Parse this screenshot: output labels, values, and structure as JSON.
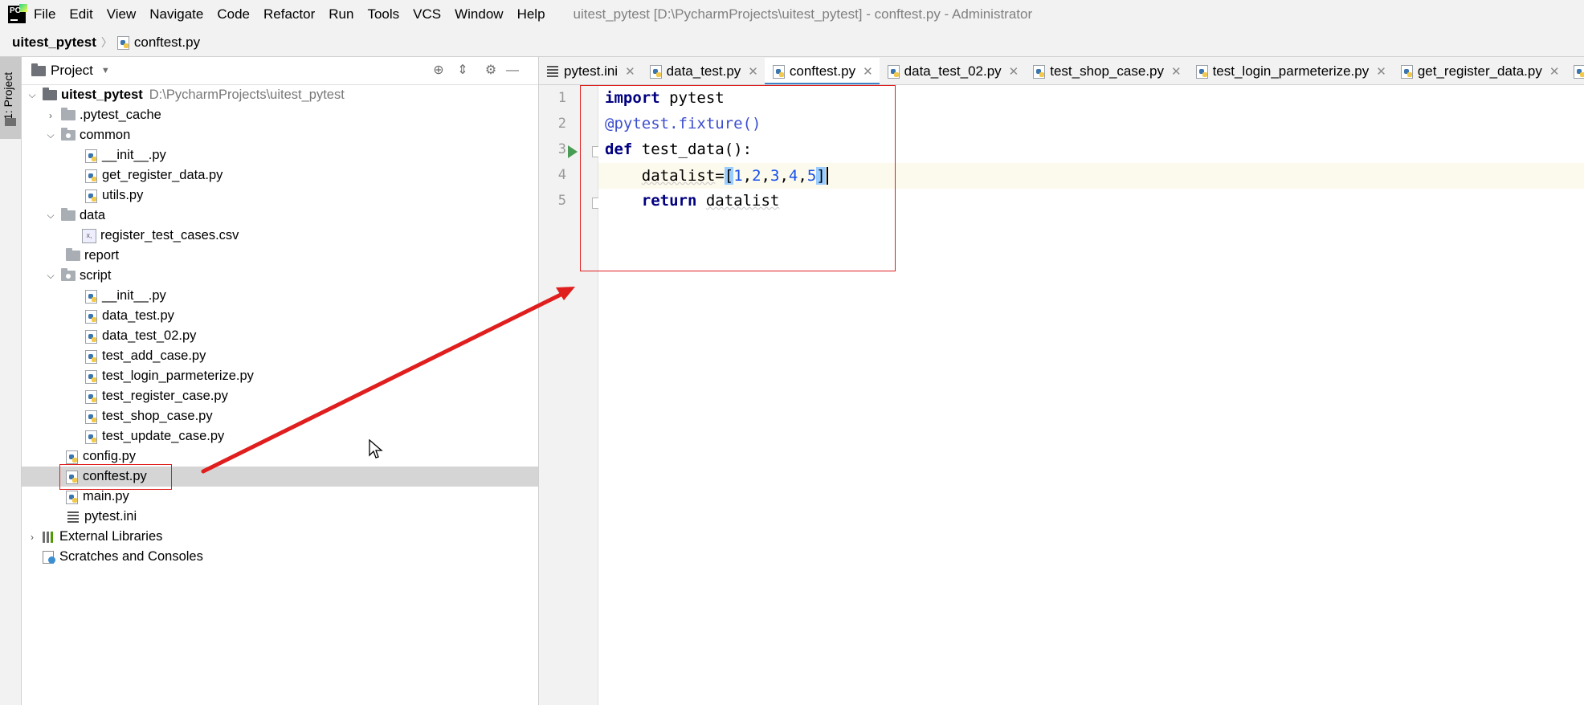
{
  "menubar": {
    "items": [
      "File",
      "Edit",
      "View",
      "Navigate",
      "Code",
      "Refactor",
      "Run",
      "Tools",
      "VCS",
      "Window",
      "Help"
    ],
    "title": "uitest_pytest [D:\\PycharmProjects\\uitest_pytest] - conftest.py - Administrator"
  },
  "breadcrumb": {
    "root": "uitest_pytest",
    "file": "conftest.py"
  },
  "tool_stripe": {
    "label": "1: Project"
  },
  "project_panel": {
    "title": "Project",
    "tree": [
      {
        "label": "uitest_pytest",
        "path": "D:\\PycharmProjects\\uitest_pytest",
        "type": "root-folder",
        "expanded": true
      },
      {
        "label": ".pytest_cache",
        "type": "folder",
        "expanded": false
      },
      {
        "label": "common",
        "type": "package",
        "expanded": true
      },
      {
        "label": "__init__.py",
        "type": "python"
      },
      {
        "label": "get_register_data.py",
        "type": "python"
      },
      {
        "label": "utils.py",
        "type": "python"
      },
      {
        "label": "data",
        "type": "folder",
        "expanded": true
      },
      {
        "label": "register_test_cases.csv",
        "type": "csv"
      },
      {
        "label": "report",
        "type": "folder"
      },
      {
        "label": "script",
        "type": "package",
        "expanded": true
      },
      {
        "label": "__init__.py",
        "type": "python"
      },
      {
        "label": "data_test.py",
        "type": "python"
      },
      {
        "label": "data_test_02.py",
        "type": "python"
      },
      {
        "label": "test_add_case.py",
        "type": "python"
      },
      {
        "label": "test_login_parmeterize.py",
        "type": "python"
      },
      {
        "label": "test_register_case.py",
        "type": "python"
      },
      {
        "label": "test_shop_case.py",
        "type": "python"
      },
      {
        "label": "test_update_case.py",
        "type": "python"
      },
      {
        "label": "config.py",
        "type": "python"
      },
      {
        "label": "conftest.py",
        "type": "python",
        "selected": true
      },
      {
        "label": "main.py",
        "type": "python"
      },
      {
        "label": "pytest.ini",
        "type": "ini"
      },
      {
        "label": "External Libraries",
        "type": "libraries",
        "expanded": false
      },
      {
        "label": "Scratches and Consoles",
        "type": "scratches"
      }
    ]
  },
  "editor": {
    "tabs": [
      {
        "label": "pytest.ini",
        "icon": "ini-file-icon"
      },
      {
        "label": "data_test.py",
        "icon": "python-file-icon"
      },
      {
        "label": "conftest.py",
        "icon": "python-file-icon",
        "active": true
      },
      {
        "label": "data_test_02.py",
        "icon": "python-file-icon"
      },
      {
        "label": "test_shop_case.py",
        "icon": "python-file-icon"
      },
      {
        "label": "test_login_parmeterize.py",
        "icon": "python-file-icon"
      },
      {
        "label": "get_register_data.py",
        "icon": "python-file-icon"
      }
    ],
    "line_numbers": [
      "1",
      "2",
      "3",
      "4",
      "5"
    ],
    "code": {
      "l1_kw": "import",
      "l1_rest": " pytest",
      "l2": "@pytest.fixture()",
      "l3_kw": "def",
      "l3_rest": " test_data():",
      "l4_indent": "    ",
      "l4_var": "datalist",
      "l4_eq": "=",
      "l4_open": "[",
      "l4_nums": [
        "1",
        "2",
        "3",
        "4",
        "5"
      ],
      "l4_close": "]",
      "l5_indent": "    ",
      "l5_kw": "return",
      "l5_rest": "datalist"
    }
  },
  "colors": {
    "annotation_red": "#e01e1e",
    "active_tab_underline": "#4083c9",
    "run_green": "#499c54"
  }
}
